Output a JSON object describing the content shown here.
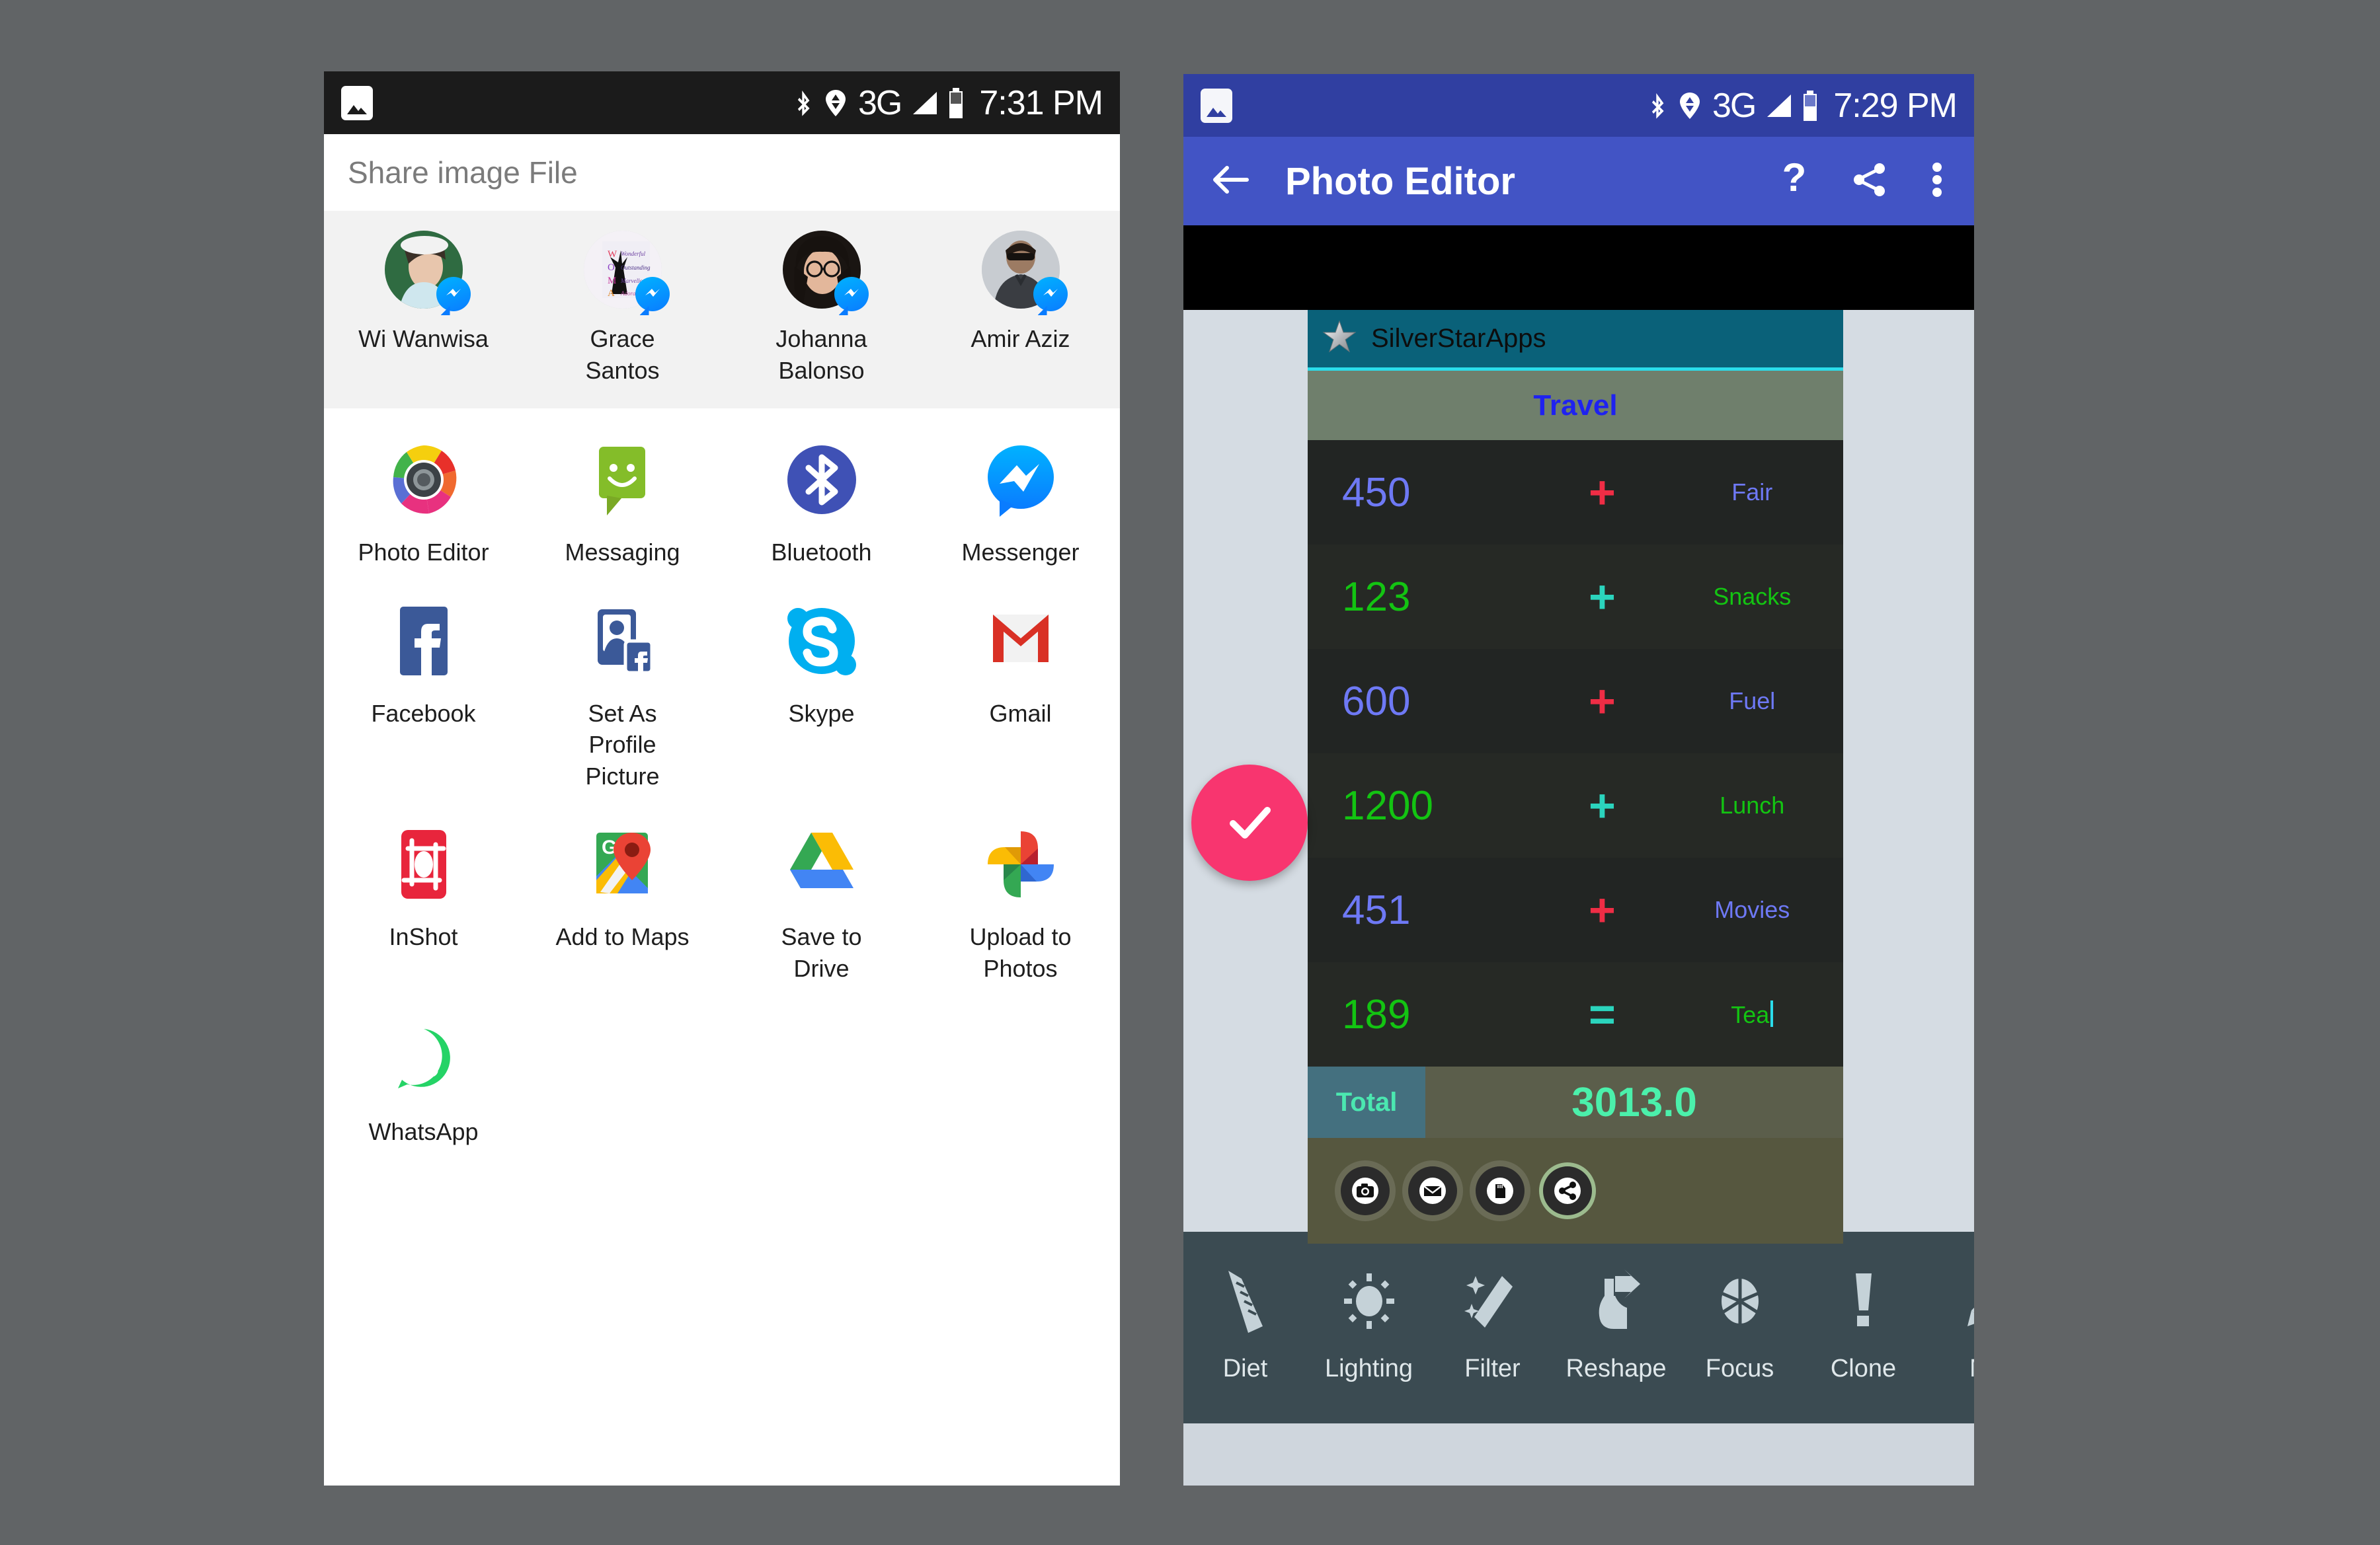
{
  "left_phone": {
    "status_bar": {
      "time": "7:31 PM",
      "network": "3G",
      "icons": [
        "photo-icon",
        "bluetooth-icon",
        "gps-icon",
        "signal-icon",
        "battery-icon"
      ]
    },
    "sheet_title": "Share image File",
    "contacts": [
      {
        "name": "Wi Wanwisa",
        "badge": "messenger-badge"
      },
      {
        "name": "Grace Santos",
        "badge": "messenger-badge"
      },
      {
        "name": "Johanna Balonso",
        "badge": "messenger-badge"
      },
      {
        "name": "Amir Aziz",
        "badge": "messenger-badge"
      }
    ],
    "apps": [
      [
        {
          "label": "Photo Editor",
          "icon": "photo-editor-icon"
        },
        {
          "label": "Messaging",
          "icon": "messaging-icon"
        },
        {
          "label": "Bluetooth",
          "icon": "bluetooth-icon"
        },
        {
          "label": "Messenger",
          "icon": "messenger-icon"
        }
      ],
      [
        {
          "label": "Facebook",
          "icon": "facebook-icon"
        },
        {
          "label": "Set As Profile Picture",
          "icon": "set-profile-picture-icon"
        },
        {
          "label": "Skype",
          "icon": "skype-icon"
        },
        {
          "label": "Gmail",
          "icon": "gmail-icon"
        }
      ],
      [
        {
          "label": "InShot",
          "icon": "inshot-icon"
        },
        {
          "label": "Add to Maps",
          "icon": "google-maps-icon"
        },
        {
          "label": "Save to Drive",
          "icon": "google-drive-icon"
        },
        {
          "label": "Upload to Photos",
          "icon": "google-photos-icon"
        }
      ],
      [
        {
          "label": "WhatsApp",
          "icon": "whatsapp-icon"
        }
      ]
    ]
  },
  "right_phone": {
    "status_bar": {
      "time": "7:29 PM",
      "network": "3G",
      "icons": [
        "photo-icon",
        "bluetooth-icon",
        "gps-icon",
        "signal-icon",
        "battery-icon"
      ]
    },
    "app_bar": {
      "title": "Photo Editor",
      "back_icon": "back-arrow-icon",
      "help_label": "?",
      "share_icon": "share-icon",
      "overflow_icon": "more-vertical-icon"
    },
    "expense_table": {
      "brand": "SilverStarApps",
      "brand_icon": "silver-star-icon",
      "header": "Travel",
      "rows": [
        {
          "amount": "450",
          "op": "+",
          "label": "Fair",
          "amount_color": "#6e79f5",
          "op_color": "#ef2d45",
          "label_color": "#6e79f5"
        },
        {
          "amount": "123",
          "op": "+",
          "label": "Snacks",
          "amount_color": "#13c412",
          "op_color": "#2bd4bd",
          "label_color": "#13c412"
        },
        {
          "amount": "600",
          "op": "+",
          "label": "Fuel",
          "amount_color": "#6e79f5",
          "op_color": "#ef2d45",
          "label_color": "#6e79f5"
        },
        {
          "amount": "1200",
          "op": "+",
          "label": "Lunch",
          "amount_color": "#13c412",
          "op_color": "#2bd4bd",
          "label_color": "#13c412"
        },
        {
          "amount": "451",
          "op": "+",
          "label": "Movies",
          "amount_color": "#6e79f5",
          "op_color": "#ef2d45",
          "label_color": "#6e79f5"
        },
        {
          "amount": "189",
          "op": "=",
          "label": "Tea",
          "amount_color": "#13c412",
          "op_color": "#2bd4bd",
          "label_color": "#13c412"
        }
      ],
      "total_label": "Total",
      "total_value": "3013.0",
      "action_buttons": [
        "camera-icon",
        "email-icon",
        "sdcard-icon",
        "share-icon"
      ]
    },
    "fab": {
      "icon": "check-icon",
      "color": "#f8356f"
    },
    "toolbar": [
      {
        "label": "Diet",
        "icon": "ruler-icon"
      },
      {
        "label": "Lighting",
        "icon": "sun-icon"
      },
      {
        "label": "Filter",
        "icon": "magic-wand-icon"
      },
      {
        "label": "Reshape",
        "icon": "reshape-icon"
      },
      {
        "label": "Focus",
        "icon": "aperture-icon"
      },
      {
        "label": "Clone",
        "icon": "tube-icon"
      },
      {
        "label": "Ma",
        "icon": "makeup-icon"
      }
    ]
  },
  "colors": {
    "background": "#616466",
    "appbar_blue": "#4254c5",
    "statusbar_blue": "#303fa1",
    "accent_pink": "#f8356f",
    "brand_teal": "#0a6179",
    "toolbar_slate": "#3b4b52"
  }
}
